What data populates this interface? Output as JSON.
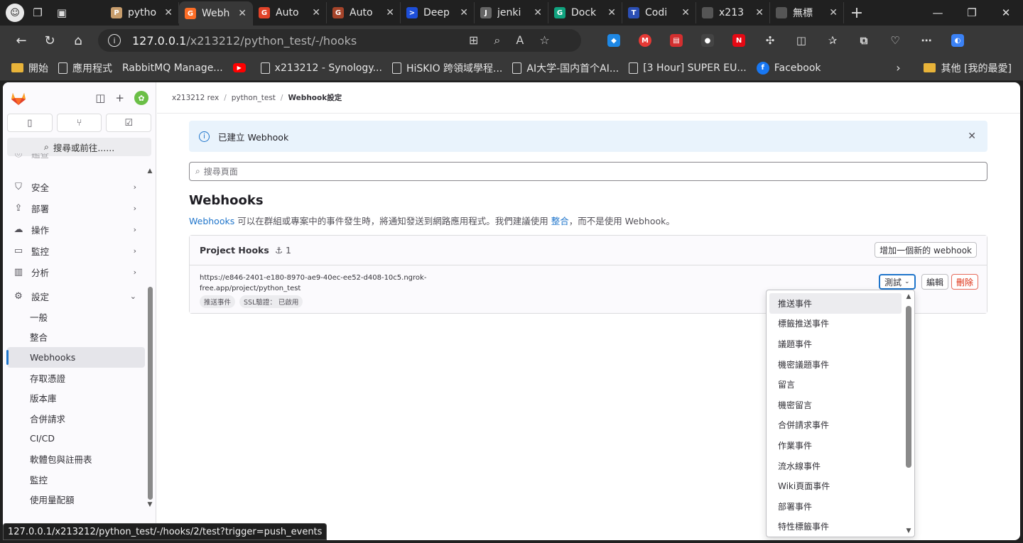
{
  "tabs": [
    {
      "label": "pytho",
      "fav": "P",
      "color": "#c79d6c"
    },
    {
      "label": "Webh",
      "fav": "G",
      "color": "#fc6d26",
      "active": true
    },
    {
      "label": "Auto",
      "fav": "G",
      "color": "#e24329"
    },
    {
      "label": "Auto",
      "fav": "G",
      "color": "#a5442a"
    },
    {
      "label": "Deep",
      "fav": ">",
      "color": "#1d4ed8"
    },
    {
      "label": "jenki",
      "fav": "J",
      "color": "#666"
    },
    {
      "label": "Dock",
      "fav": "G",
      "color": "#10a37f"
    },
    {
      "label": "Codi",
      "fav": "T",
      "color": "#2b4fb5"
    },
    {
      "label": "x213",
      "fav": "",
      "color": "#555"
    },
    {
      "label": "無標",
      "fav": "",
      "color": "#555"
    }
  ],
  "address": {
    "host": "127.0.0.1",
    "path": "/x213212/python_test/-/hooks"
  },
  "bookmarks": [
    {
      "label": "開始",
      "type": "folder"
    },
    {
      "label": "應用程式",
      "type": "page"
    },
    {
      "label": "RabbitMQ Manage...",
      "type": "none"
    },
    {
      "label": "",
      "type": "youtube"
    },
    {
      "label": "x213212 - Synology...",
      "type": "page"
    },
    {
      "label": "HiSKIO 跨領域學程...",
      "type": "page"
    },
    {
      "label": "AI大学-国内首个AI...",
      "type": "page"
    },
    {
      "label": "[3 Hour] SUPER EU...",
      "type": "page"
    },
    {
      "label": "Facebook",
      "type": "facebook"
    }
  ],
  "bookmark_other": "其他 [我的最愛]",
  "sidebar": {
    "search": "搜尋或前往......",
    "partial_item": "鑑查",
    "items": [
      {
        "label": "安全",
        "icon": "shield-icon",
        "glyph": "⛉"
      },
      {
        "label": "部署",
        "icon": "rocket-icon",
        "glyph": "⇪"
      },
      {
        "label": "操作",
        "icon": "cloud-gear-icon",
        "glyph": "☁"
      },
      {
        "label": "監控",
        "icon": "monitor-icon",
        "glyph": "▭"
      },
      {
        "label": "分析",
        "icon": "chart-icon",
        "glyph": "▥"
      }
    ],
    "settings": {
      "label": "設定",
      "icon": "settings-icon"
    },
    "sub_items": [
      "一般",
      "整合",
      "Webhooks",
      "存取憑證",
      "版本庫",
      "合併請求",
      "CI/CD",
      "軟體包與註冊表",
      "監控",
      "使用量配額"
    ],
    "active_sub": "Webhooks"
  },
  "breadcrumbs": {
    "user": "x213212 rex",
    "project": "python_test",
    "current": "Webhook設定"
  },
  "alert": "已建立 Webhook",
  "search_placeholder": "搜尋頁面",
  "heading": "Webhooks",
  "description": {
    "link1": "Webhooks",
    "text1": " 可以在群組或專案中的事件發生時，將通知發送到網路應用程式。我們建議使用 ",
    "link2": "整合",
    "text2": "，而不是使用 Webhook。"
  },
  "hooks": {
    "title": "Project Hooks",
    "count": "1",
    "add_button": "增加一個新的 webhook",
    "url_line1": "https://e846-2401-e180-8970-ae9-40ec-ee52-d408-10c5.ngrok-",
    "url_line2": "free.app/project/python_test",
    "badge1": "推送事件",
    "badge2": "SSL驗證： 已啟用",
    "test": "測試",
    "edit": "編輯",
    "delete": "刪除"
  },
  "dropdown": [
    "推送事件",
    "標籤推送事件",
    "議題事件",
    "機密議題事件",
    "留言",
    "機密留言",
    "合併請求事件",
    "作業事件",
    "流水線事件",
    "Wiki頁面事件",
    "部署事件",
    "特性標籤事件"
  ],
  "status_url": "127.0.0.1/x213212/python_test/-/hooks/2/test?trigger=push_events"
}
